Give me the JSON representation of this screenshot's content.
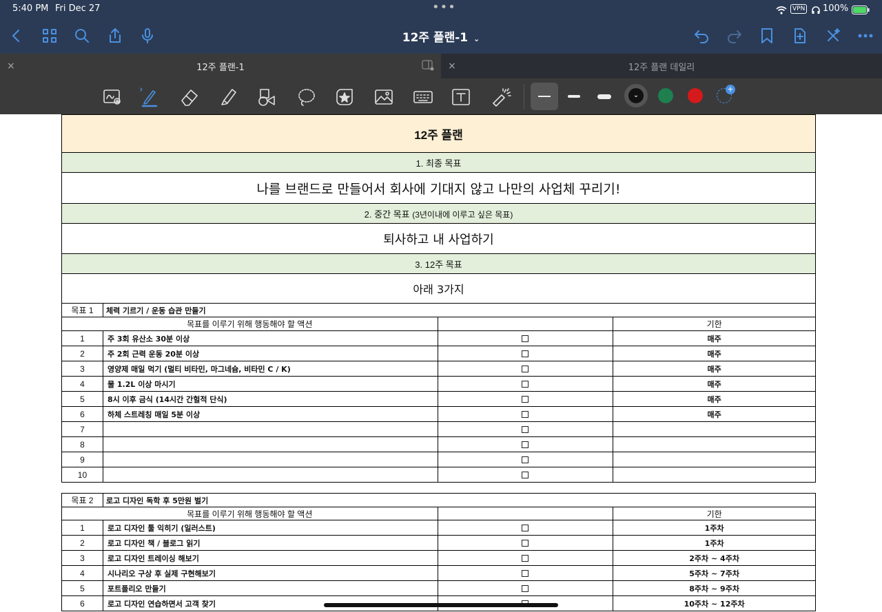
{
  "status_bar": {
    "time": "5:40 PM",
    "date": "Fri Dec 27",
    "vpn": "VPN",
    "battery": "100%"
  },
  "nav": {
    "title": "12주 플랜-1"
  },
  "tabs": [
    {
      "label": "12주 플랜-1",
      "close": "×"
    },
    {
      "label": "12주 플랜 데일리",
      "close": "×"
    }
  ],
  "toolbar": {
    "tools": [
      "lasso-image-icon",
      "pen-icon",
      "eraser-icon",
      "highlighter-icon",
      "shapes-icon",
      "lasso-icon",
      "sticker-icon",
      "image-icon",
      "keyboard-icon",
      "text-icon",
      "laser-icon"
    ],
    "colors": [
      "#111111",
      "#1e7f4f",
      "#d41a1a"
    ]
  },
  "plan": {
    "title": "12주 플랜",
    "s1_header": "1. 최종 목표",
    "s1_text": "나를 브랜드로 만들어서 회사에 기대지 않고 나만의 사업체 꾸리기!",
    "s2_header": "2. 중간 목표",
    "s2_header_note": "(3년이내에 이루고 싶은 목표)",
    "s2_text": "퇴사하고 내 사업하기",
    "s3_header": "3. 12주 목표",
    "s3_text": "아래 3가지",
    "goal1": {
      "label": "목표 1",
      "text": "체력 기르기 / 운동 습관 만들기",
      "action_header": "목표를 이루기 위해 행동해야 할 액션",
      "deadline_header": "기한",
      "rows": [
        {
          "n": "1",
          "action": "주 3회 유산소 30분 이상",
          "deadline": "매주"
        },
        {
          "n": "2",
          "action": "주 2회 근력 운동 20분 이상",
          "deadline": "매주"
        },
        {
          "n": "3",
          "action": "영양제 매일 먹기 (멀티 비타민, 마그네슘, 비타민 C / K)",
          "deadline": "매주"
        },
        {
          "n": "4",
          "action": "물 1.2L 이상 마시기",
          "deadline": "매주"
        },
        {
          "n": "5",
          "action": "8시 이후 금식 (14시간 간헐적 단식)",
          "deadline": "매주"
        },
        {
          "n": "6",
          "action": "하체 스트레칭 매일 5분 이상",
          "deadline": "매주"
        },
        {
          "n": "7",
          "action": "",
          "deadline": ""
        },
        {
          "n": "8",
          "action": "",
          "deadline": ""
        },
        {
          "n": "9",
          "action": "",
          "deadline": ""
        },
        {
          "n": "10",
          "action": "",
          "deadline": ""
        }
      ]
    },
    "goal2": {
      "label": "목표 2",
      "text": "로고 디자인 독학 후 5만원 벌기",
      "action_header": "목표를 이루기 위해 행동해야 할 액션",
      "deadline_header": "기한",
      "rows": [
        {
          "n": "1",
          "action": "로고 디자인 툴 익히기 (일러스트)",
          "deadline": "1주차"
        },
        {
          "n": "2",
          "action": "로고 디자인 책 / 블로그 읽기",
          "deadline": "1주차"
        },
        {
          "n": "3",
          "action": "로고 디자인 트레이싱 해보기",
          "deadline": "2주차 ~ 4주차"
        },
        {
          "n": "4",
          "action": "시나리오 구상 후 실제 구현해보기",
          "deadline": "5주차 ~ 7주차"
        },
        {
          "n": "5",
          "action": "포트폴리오 만들기",
          "deadline": "8주차 ~ 9주차"
        },
        {
          "n": "6",
          "action": "로고 디자인 연습하면서 고객 찾기",
          "deadline": "10주차 ~ 12주차"
        }
      ]
    }
  }
}
